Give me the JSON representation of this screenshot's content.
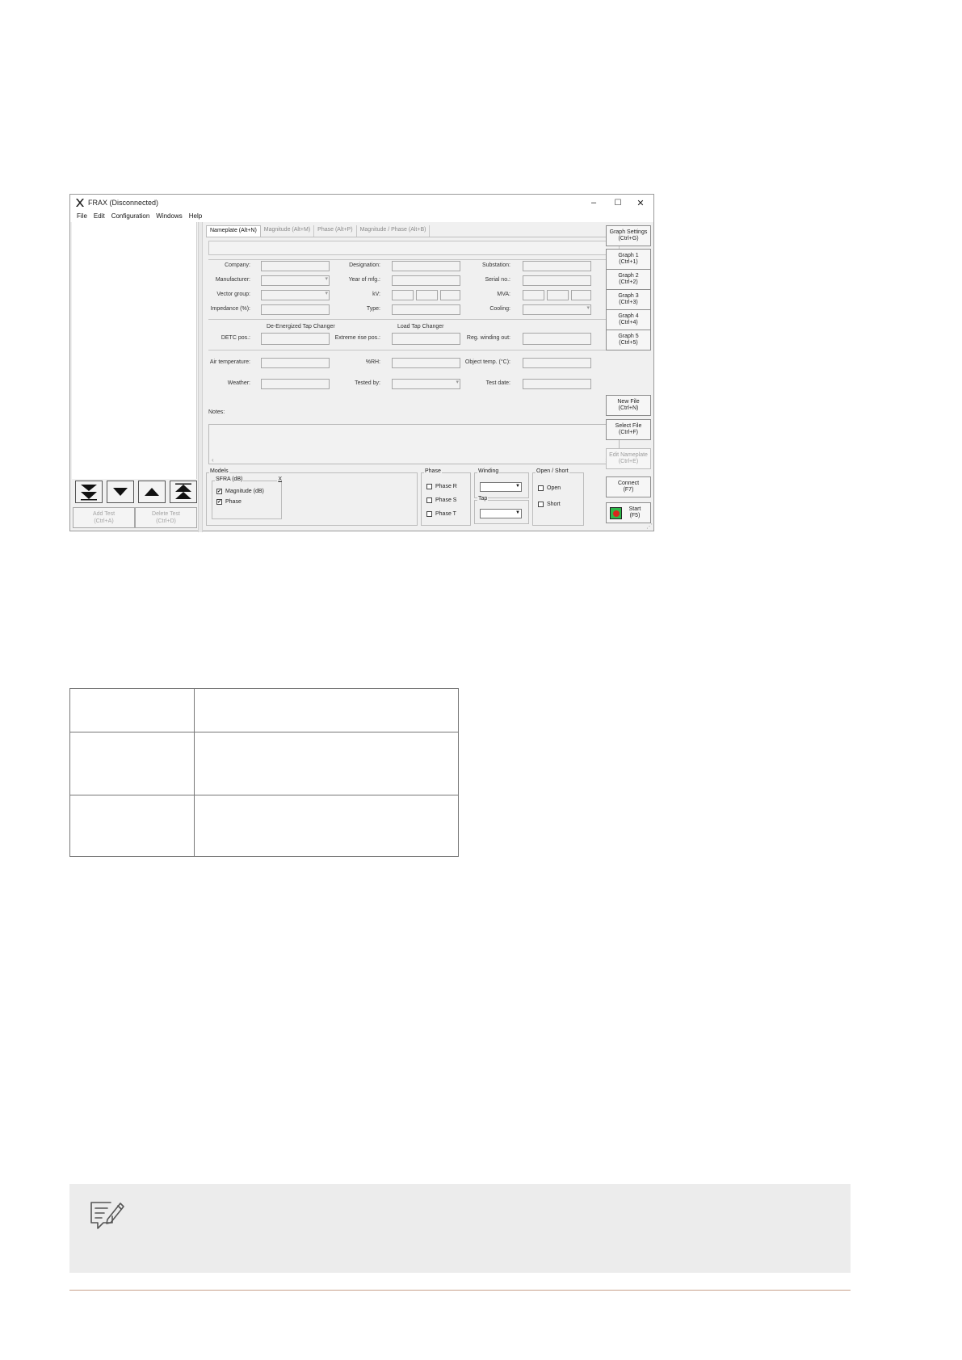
{
  "window": {
    "title": "FRAX (Disconnected)",
    "controls": {
      "minimize": "–",
      "maximize": "☐",
      "close": "✕"
    }
  },
  "menu": [
    "File",
    "Edit",
    "Configuration",
    "Windows",
    "Help"
  ],
  "tabs": [
    "Nameplate (Alt+N)",
    "Magnitude (Alt+M)",
    "Phase (Alt+P)",
    "Magnitude / Phase (Alt+B)"
  ],
  "form": {
    "company": "Company:",
    "manufacturer": "Manufacturer:",
    "vector_group": "Vector group:",
    "impedance": "Impedance (%):",
    "designation": "Designation:",
    "year_of_mfg": "Year of mfg.:",
    "kv": "kV:",
    "type": "Type:",
    "substation": "Substation:",
    "serial_no": "Serial no.:",
    "mva": "MVA:",
    "cooling": "Cooling:",
    "de_energized_heading": "De-Energized Tap Changer",
    "load_tap_heading": "Load Tap Changer",
    "detc_pos": "DETC pos.:",
    "extreme_rise_pos": "Extreme rise pos.:",
    "reg_winding_out": "Reg. winding out:",
    "air_temperature": "Air temperature:",
    "rh": "%RH:",
    "object_temp": "Object temp. (°C):",
    "weather": "Weather:",
    "tested_by": "Tested by:",
    "test_date": "Test date:",
    "notes": "Notes:"
  },
  "left_panel": {
    "add_test": [
      "Add Test",
      "(Ctrl+A)"
    ],
    "delete_test": [
      "Delete Test",
      "(Ctrl+D)"
    ]
  },
  "models": {
    "title": "Models",
    "sfra": "SFRA (dB)",
    "close": "X",
    "magnitude": "Magnitude (dB)",
    "phase": "Phase",
    "magnitude_checked": "✔",
    "phase_checked": "✔"
  },
  "phase_group": {
    "title": "Phase",
    "r": "Phase R",
    "s": "Phase S",
    "t": "Phase T"
  },
  "winding_group": {
    "title": "Winding",
    "tap": "Tap"
  },
  "open_short_group": {
    "title": "Open / Short",
    "open": "Open",
    "short": "Short"
  },
  "right_buttons": {
    "graph_settings": [
      "Graph Settings",
      "(Ctrl+G)"
    ],
    "graph1": [
      "Graph 1",
      "(Ctrl+1)"
    ],
    "graph2": [
      "Graph 2",
      "(Ctrl+2)"
    ],
    "graph3": [
      "Graph 3",
      "(Ctrl+3)"
    ],
    "graph4": [
      "Graph 4",
      "(Ctrl+4)"
    ],
    "graph5": [
      "Graph 5",
      "(Ctrl+5)"
    ],
    "new_file": [
      "New File",
      "(Ctrl+N)"
    ],
    "select_file": [
      "Select File",
      "(Ctrl+F)"
    ],
    "edit_nameplate": [
      "Edit Nameplate",
      "(Ctrl+E)"
    ],
    "connect": [
      "Connect",
      "(F7)"
    ],
    "start": [
      "Start",
      "(F5)"
    ]
  },
  "colors": {
    "start_green": "#2db84a",
    "start_red": "#d9261c",
    "note_bg": "#ececec",
    "rule": "#c8a08a"
  }
}
